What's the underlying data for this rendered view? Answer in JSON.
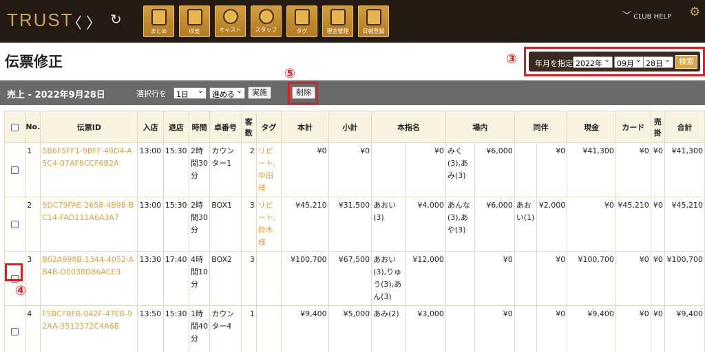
{
  "header": {
    "logo": "TRUST",
    "nav_back": "〈",
    "nav_forward": "〉",
    "nav_reload": "↻",
    "tools": [
      {
        "label": "まとめ"
      },
      {
        "label": "収支"
      },
      {
        "label": "キャスト"
      },
      {
        "label": "スタッフ"
      },
      {
        "label": "タグ"
      },
      {
        "label": "現金管理"
      },
      {
        "label": "日報登録"
      }
    ],
    "club_help": "CLUB HELP",
    "gear": "⚙"
  },
  "page_title": "伝票修正",
  "annotations": {
    "date": "③",
    "delete": "⑤",
    "checkbox": "④"
  },
  "date_filter": {
    "label": "年月を指定",
    "year": "2022年",
    "month": "09月",
    "day": "28日",
    "search": "検索"
  },
  "action_bar": {
    "title": "売上 - 2022年9月28日",
    "select_label": "選択行を",
    "period": "1日",
    "action": "進める",
    "execute": "実施",
    "delete": "削除"
  },
  "table": {
    "headers": [
      "No.",
      "伝票ID",
      "入店",
      "退店",
      "時間",
      "卓番号",
      "客数",
      "タグ",
      "本計",
      "小計",
      "本指名",
      "場内",
      "同伴",
      "現金",
      "カード",
      "売掛",
      "合計"
    ],
    "rows": [
      {
        "no": "1",
        "id": "5B6F5FF1-9BFF-49D4-A5C4-07AF8CCF6B2A",
        "in": "13:00",
        "out": "15:30",
        "time": "2時間30分",
        "table": "カウンター1",
        "guests": "2",
        "tag": "リピート,",
        "tag2": "中田様",
        "honkei": "¥0",
        "shokei": "¥0",
        "shimei_name": "",
        "shimei_amt": "¥0",
        "jonai_name": "みく(3),あみ(3)",
        "jonai_amt": "¥6,000",
        "dohan_name": "",
        "dohan_amt": "¥0",
        "cash": "¥41,300",
        "card": "¥0",
        "urikake": "¥0",
        "total": "¥41,300"
      },
      {
        "no": "2",
        "id": "5DC79FAE-2658-4B9B-BC14-FAD111A6A3A7",
        "in": "13:00",
        "out": "15:30",
        "time": "2時間30分",
        "table": "BOX1",
        "guests": "3",
        "tag": "リピート,",
        "tag2": "鈴木様",
        "honkei": "¥45,210",
        "shokei": "¥31,500",
        "shimei_name": "あおい(3)",
        "shimei_amt": "¥4,000",
        "jonai_name": "あんな(3),あや(3)",
        "jonai_amt": "¥6,000",
        "dohan_name": "あおい(1)",
        "dohan_amt": "¥2,000",
        "cash": "¥0",
        "card": "¥45,210",
        "urikake": "¥0",
        "total": "¥45,210"
      },
      {
        "no": "3",
        "id": "B02A998B-1344-4052-AB4B-D0038D86ACE3",
        "in": "13:30",
        "out": "17:40",
        "time": "4時間10分",
        "table": "BOX2",
        "guests": "3",
        "tag": "",
        "tag2": "",
        "honkei": "¥100,700",
        "shokei": "¥67,500",
        "shimei_name": "あおい(3),りゅう(3),あん(3)",
        "shimei_amt": "¥12,000",
        "jonai_name": "",
        "jonai_amt": "¥0",
        "dohan_name": "",
        "dohan_amt": "¥0",
        "cash": "¥100,700",
        "card": "¥0",
        "urikake": "¥0",
        "total": "¥100,700"
      },
      {
        "no": "4",
        "id": "F5BCFBFB-042F-47EB-92AA-3512372C4A6B",
        "in": "13:50",
        "out": "15:30",
        "time": "1時間40分",
        "table": "カウンター4",
        "guests": "1",
        "tag": "",
        "tag2": "",
        "honkei": "¥9,400",
        "shokei": "¥5,000",
        "shimei_name": "あみ(2)",
        "shimei_amt": "¥3,000",
        "jonai_name": "",
        "jonai_amt": "¥0",
        "dohan_name": "",
        "dohan_amt": "¥0",
        "cash": "¥9,400",
        "card": "¥0",
        "urikake": "¥0",
        "total": "¥9,400"
      }
    ]
  }
}
